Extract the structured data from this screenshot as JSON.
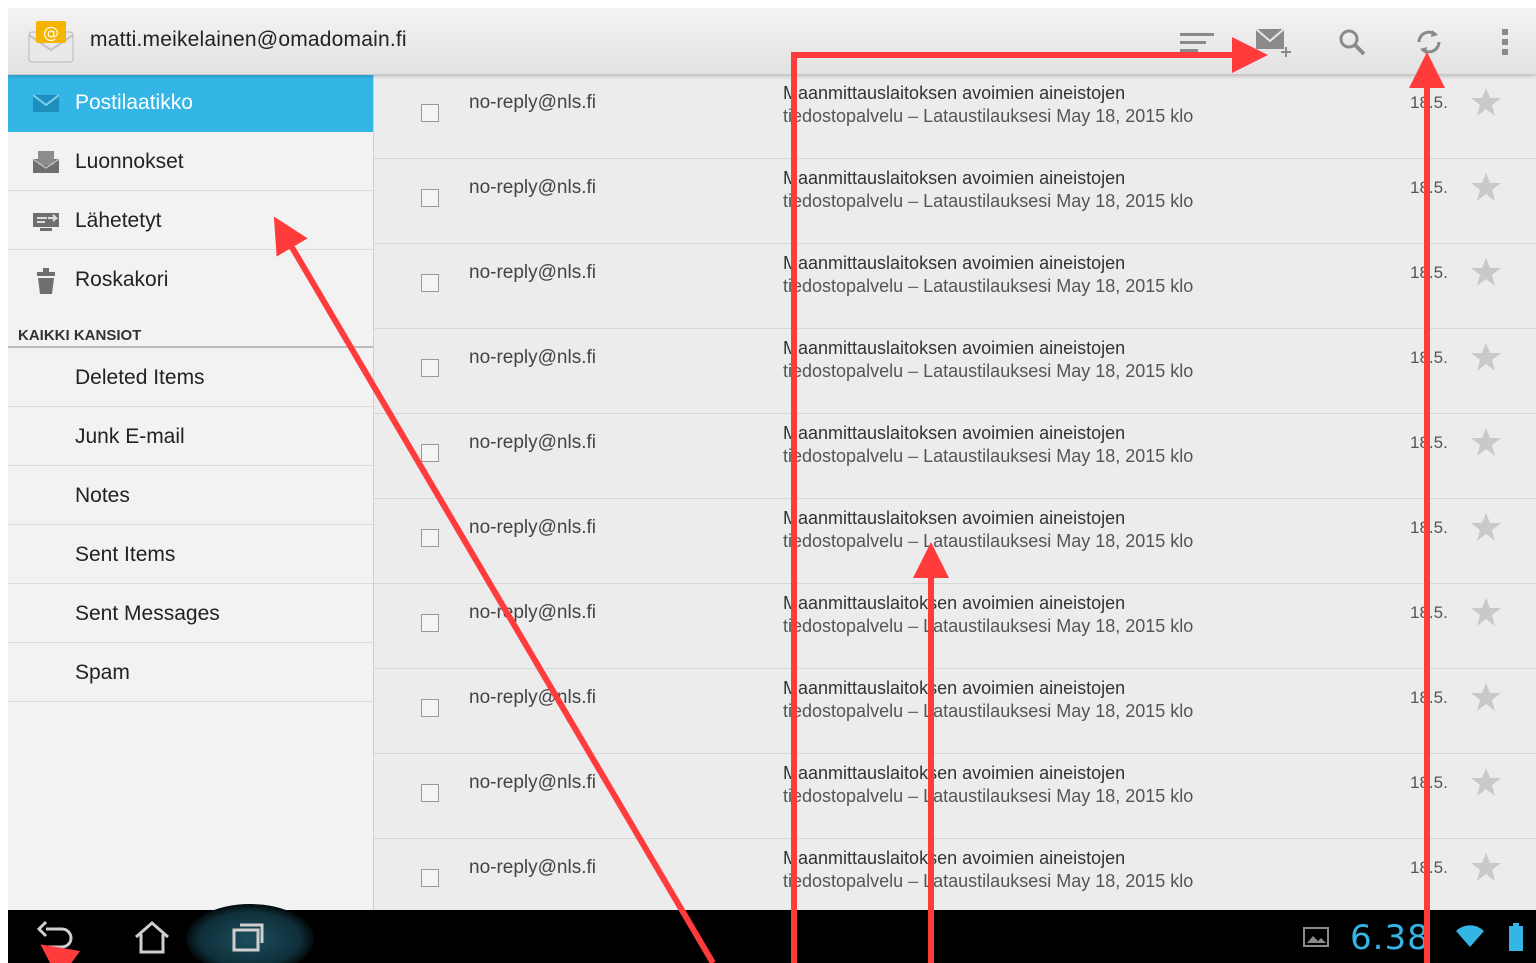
{
  "topbar": {
    "account": "matti.meikelainen@omadomain.fi",
    "icons": [
      "sort-icon",
      "compose-icon",
      "search-icon",
      "refresh-icon",
      "overflow-menu-icon"
    ]
  },
  "sidebar": {
    "items": [
      {
        "label": "Postilaatikko",
        "icon": "inbox-icon",
        "active": true
      },
      {
        "label": "Luonnokset",
        "icon": "drafts-icon"
      },
      {
        "label": "Lähetetyt",
        "icon": "sent-icon"
      },
      {
        "label": "Roskakori",
        "icon": "trash-icon"
      }
    ],
    "section_header": "KAIKKI KANSIOT",
    "folders": [
      "Deleted Items",
      "Junk E-mail",
      "Notes",
      "Sent Items",
      "Sent Messages",
      "Spam"
    ]
  },
  "messages": [
    {
      "sender": "no-reply@nls.fi",
      "subject": "Maanmittauslaitoksen avoimien aineistojen",
      "snippet_a": "tiedostopalvelu",
      "separator": "–",
      "snippet_b": "Lataustilauksesi May 18, 2015 klo",
      "date": "18.5."
    },
    {
      "sender": "no-reply@nls.fi",
      "subject": "Maanmittauslaitoksen avoimien aineistojen",
      "snippet_a": "tiedostopalvelu",
      "separator": "–",
      "snippet_b": "Lataustilauksesi May 18, 2015 klo",
      "date": "18.5."
    },
    {
      "sender": "no-reply@nls.fi",
      "subject": "Maanmittauslaitoksen avoimien aineistojen",
      "snippet_a": "tiedostopalvelu",
      "separator": "–",
      "snippet_b": "Lataustilauksesi May 18, 2015 klo",
      "date": "18.5."
    },
    {
      "sender": "no-reply@nls.fi",
      "subject": "Maanmittauslaitoksen avoimien aineistojen",
      "snippet_a": "tiedostopalvelu",
      "separator": "–",
      "snippet_b": "Lataustilauksesi May 18, 2015 klo",
      "date": "18.5."
    },
    {
      "sender": "no-reply@nls.fi",
      "subject": "Maanmittauslaitoksen avoimien aineistojen",
      "snippet_a": "tiedostopalvelu",
      "separator": "–",
      "snippet_b": "Lataustilauksesi May 18, 2015 klo",
      "date": "18.5."
    },
    {
      "sender": "no-reply@nls.fi",
      "subject": "Maanmittauslaitoksen avoimien aineistojen",
      "snippet_a": "tiedostopalvelu",
      "separator": "–",
      "snippet_b": "Lataustilauksesi May 18, 2015 klo",
      "date": "18.5."
    },
    {
      "sender": "no-reply@nls.fi",
      "subject": "Maanmittauslaitoksen avoimien aineistojen",
      "snippet_a": "tiedostopalvelu",
      "separator": "–",
      "snippet_b": "Lataustilauksesi May 18, 2015 klo",
      "date": "18.5."
    },
    {
      "sender": "no-reply@nls.fi",
      "subject": "Maanmittauslaitoksen avoimien aineistojen",
      "snippet_a": "tiedostopalvelu",
      "separator": "–",
      "snippet_b": "Lataustilauksesi May 18, 2015 klo",
      "date": "18.5."
    },
    {
      "sender": "no-reply@nls.fi",
      "subject": "Maanmittauslaitoksen avoimien aineistojen",
      "snippet_a": "tiedostopalvelu",
      "separator": "–",
      "snippet_b": "Lataustilauksesi May 18, 2015 klo",
      "date": "18.5."
    },
    {
      "sender": "no-reply@nls.fi",
      "subject": "Maanmittauslaitoksen avoimien aineistojen",
      "snippet_a": "tiedostopalvelu",
      "separator": "–",
      "snippet_b": "Lataustilauksesi May 18, 2015 klo",
      "date": "18.5."
    }
  ],
  "navbar": {
    "clock": "6.38",
    "icons": [
      "back-icon",
      "home-icon",
      "recent-apps-icon",
      "gallery-icon",
      "wifi-icon",
      "battery-icon"
    ]
  },
  "colors": {
    "accent": "#33b5e5",
    "annotation": "#ff3b3b"
  }
}
